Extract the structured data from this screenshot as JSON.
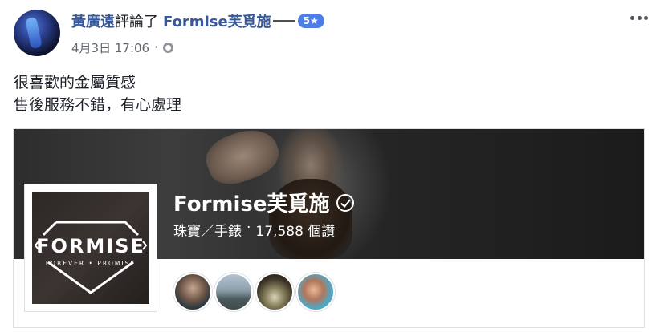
{
  "post": {
    "author": "黃廣遠",
    "action": "評論了",
    "page_link": "Formise芙覓施",
    "rating": "5★",
    "timestamp": "4月3日 17:06",
    "meta_sep": "·",
    "privacy_icon": "globe-icon",
    "more_icon": "more-options-icon",
    "text_lines": [
      "很喜歡的金屬質感",
      "售後服務不錯，有心處理"
    ]
  },
  "page_card": {
    "name": "Formise芙覓施",
    "verified_icon": "verified-check-icon",
    "category": "珠寶／手錶",
    "sep": "·",
    "likes": "17,588 個讚",
    "logo": {
      "wordmark": "FORMISE",
      "tagline": "FOREVER • PROMISE"
    },
    "friend_avatars": 4
  },
  "colors": {
    "link": "#365899",
    "badge": "#4c7ee8",
    "meta": "#616770"
  }
}
